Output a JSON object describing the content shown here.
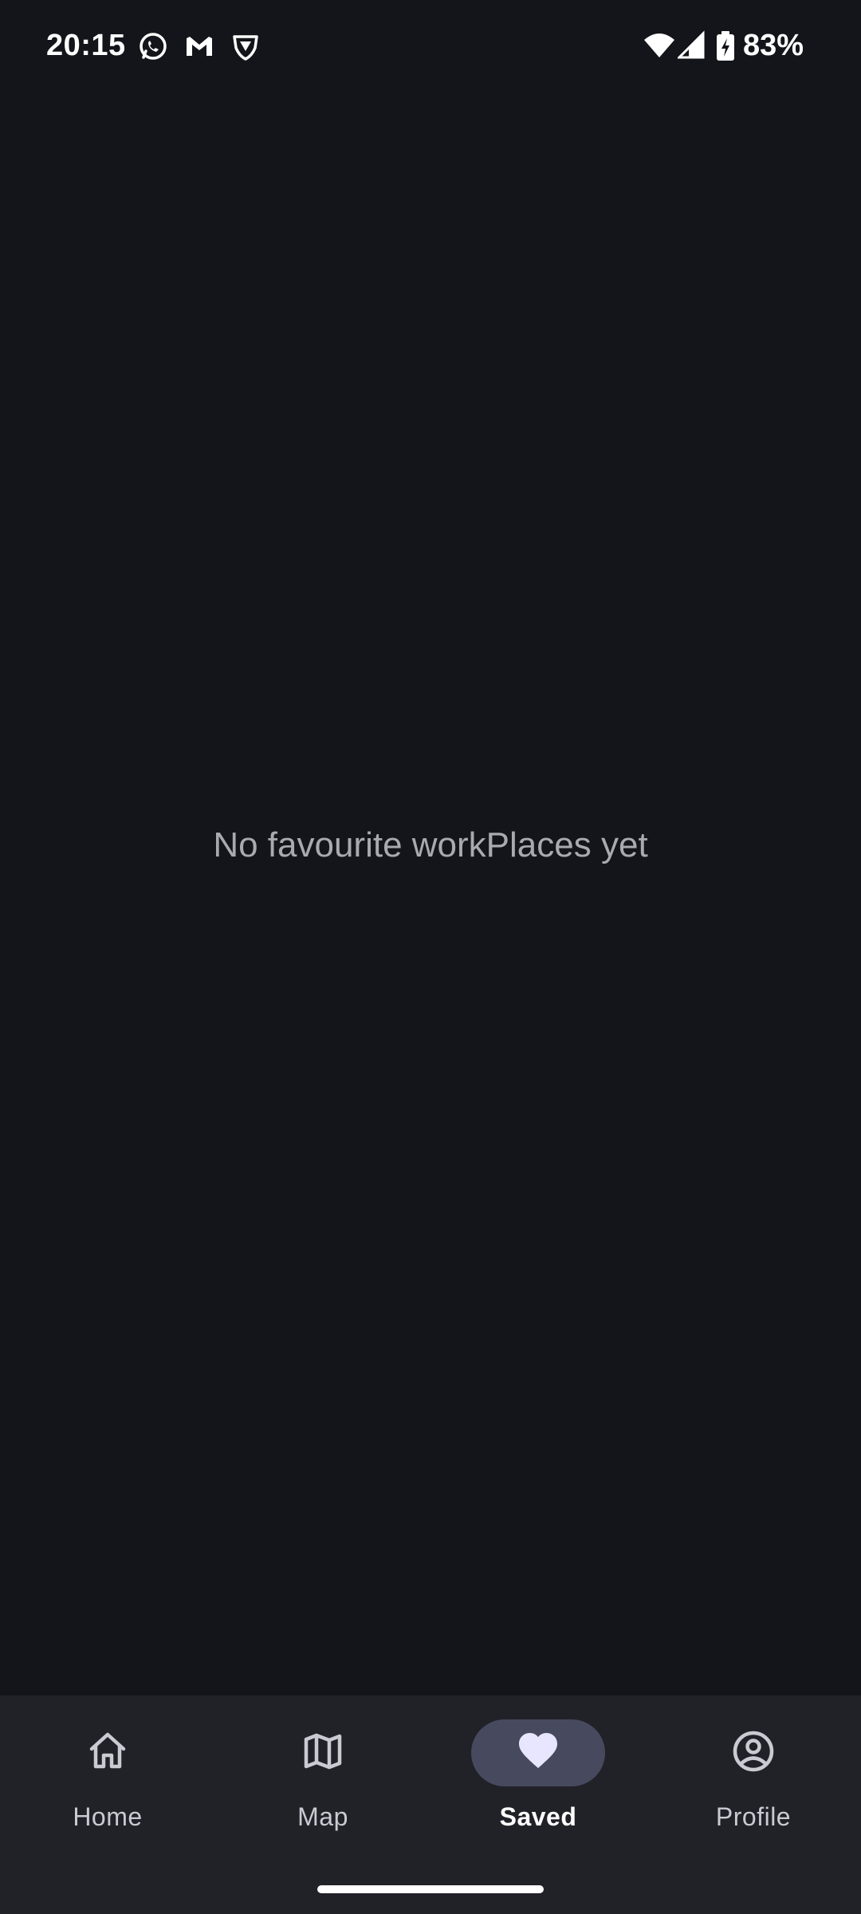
{
  "status_bar": {
    "time": "20:15",
    "notification_icons": [
      "whatsapp-icon",
      "gmail-icon",
      "vpn-shield-icon"
    ],
    "battery_text": "83%",
    "battery_level": 83
  },
  "main": {
    "empty_message": "No favourite workPlaces yet"
  },
  "bottom_nav": {
    "items": [
      {
        "label": "Home",
        "icon": "home-icon",
        "active": false
      },
      {
        "label": "Map",
        "icon": "map-icon",
        "active": false
      },
      {
        "label": "Saved",
        "icon": "heart-icon",
        "active": true
      },
      {
        "label": "Profile",
        "icon": "profile-icon",
        "active": false
      }
    ]
  },
  "colors": {
    "background": "#14151a",
    "nav_background": "#212128",
    "active_indicator": "#474a5e",
    "active_icon": "#e8e6ff",
    "empty_text": "#a9aab0"
  }
}
